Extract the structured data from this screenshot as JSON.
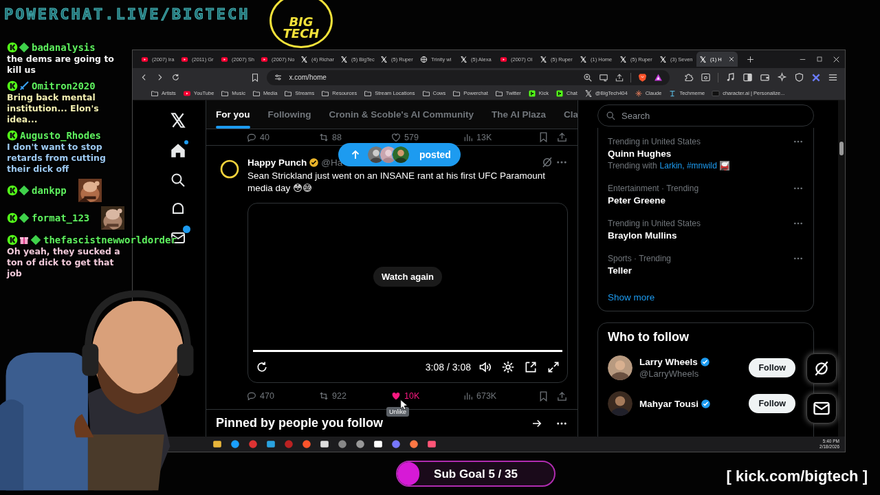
{
  "overlay": {
    "site_title": "POWERCHAT.LIVE/BIGTECH",
    "logo": "BIG TECH"
  },
  "chat": [
    {
      "badges": [
        {
          "kind": "kick"
        },
        {
          "kind": "diamond"
        }
      ],
      "user": "badanalysis",
      "kind": "text",
      "message": "the dems are going to kill us",
      "color": "#f2f2f2"
    },
    {
      "badges": [
        {
          "kind": "kick"
        },
        {
          "kind": "sword"
        }
      ],
      "user": "Omitron2020",
      "kind": "text",
      "message": "Bring back mental institution... Elon's idea...",
      "color": "#f3efb0"
    },
    {
      "badges": [
        {
          "kind": "kick"
        }
      ],
      "user": "Augusto_Rhodes",
      "kind": "text",
      "message": "I don't want to stop retards from cutting their dick off",
      "color": "#9cc8f0"
    },
    {
      "badges": [
        {
          "kind": "kick"
        },
        {
          "kind": "diamond"
        }
      ],
      "user": "dankpp",
      "kind": "emote"
    },
    {
      "badges": [
        {
          "kind": "kick"
        },
        {
          "kind": "diamond"
        }
      ],
      "user": "format_123",
      "kind": "emote"
    },
    {
      "badges": [
        {
          "kind": "kick"
        },
        {
          "kind": "gift"
        },
        {
          "kind": "diamond"
        }
      ],
      "user": "thefascistnewworldorder",
      "kind": "text",
      "message": "Oh yeah, they sucked a ton of dick to get that job",
      "color": "#f0c8d8"
    }
  ],
  "browser": {
    "tabs": [
      {
        "kind": "youtube",
        "title": "(2007) Ira",
        "selected": false
      },
      {
        "kind": "youtube",
        "title": "(2011) Gr",
        "selected": false
      },
      {
        "kind": "youtube",
        "title": "(2007) Sh",
        "selected": false
      },
      {
        "kind": "youtube",
        "title": "(2007) No",
        "selected": false
      },
      {
        "kind": "x",
        "title": "(4) Richar",
        "selected": false
      },
      {
        "kind": "x",
        "title": "(5) BigTec",
        "selected": false
      },
      {
        "kind": "x",
        "title": "(5) Ruper",
        "selected": false
      },
      {
        "kind": "globe",
        "title": "Trinity wi",
        "selected": false
      },
      {
        "kind": "x",
        "title": "(5) Alexa",
        "selected": false
      },
      {
        "kind": "youtube",
        "title": "(2007) Ol",
        "selected": false
      },
      {
        "kind": "x",
        "title": "(5) Ruper",
        "selected": false
      },
      {
        "kind": "x",
        "title": "(1) Home",
        "selected": false
      },
      {
        "kind": "x",
        "title": "(5) Ruper",
        "selected": false
      },
      {
        "kind": "x",
        "title": "(3) Seven",
        "selected": false
      },
      {
        "kind": "x",
        "title": "(1) H",
        "selected": true
      }
    ],
    "url": "x.com/home",
    "bookmarks": [
      {
        "kind": "folder",
        "label": "Artists"
      },
      {
        "kind": "youtube",
        "label": "YouTube"
      },
      {
        "kind": "folder",
        "label": "Music"
      },
      {
        "kind": "folder",
        "label": "Media"
      },
      {
        "kind": "folder",
        "label": "Streams"
      },
      {
        "kind": "folder",
        "label": "Resources"
      },
      {
        "kind": "folder",
        "label": "Stream Locations"
      },
      {
        "kind": "folder",
        "label": "Cows"
      },
      {
        "kind": "folder",
        "label": "Powerchat"
      },
      {
        "kind": "folder",
        "label": "Twitter"
      },
      {
        "kind": "kick",
        "label": "Kick"
      },
      {
        "kind": "kick",
        "label": "Chat"
      },
      {
        "kind": "x",
        "label": "@BigTech404"
      },
      {
        "kind": "claude",
        "label": "Claude"
      },
      {
        "kind": "techmeme",
        "label": "Techmeme"
      },
      {
        "kind": "charai",
        "label": "character.ai | Personalize..."
      }
    ]
  },
  "feed": {
    "tabs": [
      {
        "label": "For you",
        "selected": true
      },
      {
        "label": "Following",
        "selected": false
      },
      {
        "label": "Cronin & Scoble's AI Community",
        "selected": false
      },
      {
        "label": "The AI Plaza",
        "selected": false
      },
      {
        "label": "Cla",
        "selected": false
      }
    ],
    "previous_post_stats": {
      "replies": "40",
      "reposts": "88",
      "likes": "579",
      "views": "13K"
    },
    "new_posts_pill": "posted",
    "post": {
      "author": "Happy Punch",
      "verified": true,
      "handle": "@Ha",
      "text": "Sean Strickland just went on an INSANE rant at his first UFC Paramount media day 😳😅",
      "video": {
        "button": "Watch again",
        "time": "3:08 / 3:08",
        "level": 1
      },
      "stats": {
        "replies": "470",
        "reposts": "922",
        "likes": "10K",
        "liked": true,
        "views": "673K"
      },
      "tooltip": "Unlike"
    },
    "pinned_heading": "Pinned by people you follow"
  },
  "sidebar": {
    "search_placeholder": "Search",
    "trends": [
      {
        "context": "Trending in United States",
        "name": "Quinn Hughes",
        "related_label": "Trending with",
        "related": "Larkin, #mnwild"
      },
      {
        "context": "Entertainment · Trending",
        "name": "Peter Greene"
      },
      {
        "context": "Trending in United States",
        "name": "Braylon Mullins"
      },
      {
        "context": "Sports · Trending",
        "name": "Teller"
      }
    ],
    "show_more": "Show more",
    "who_to_follow": {
      "title": "Who to follow",
      "users": [
        {
          "name": "Larry Wheels",
          "handle": "@LarryWheels",
          "verified": true,
          "button": "Follow"
        },
        {
          "name": "Mahyar Tousi",
          "verified": true,
          "button": "Follow"
        }
      ]
    }
  },
  "taskbar": {
    "time": "5:40 PM",
    "date": "2/18/2026"
  },
  "sub_goal": {
    "label": "Sub Goal 5 / 35",
    "level": 0.14
  },
  "footer_link": "[ kick.com/bigtech ]"
}
